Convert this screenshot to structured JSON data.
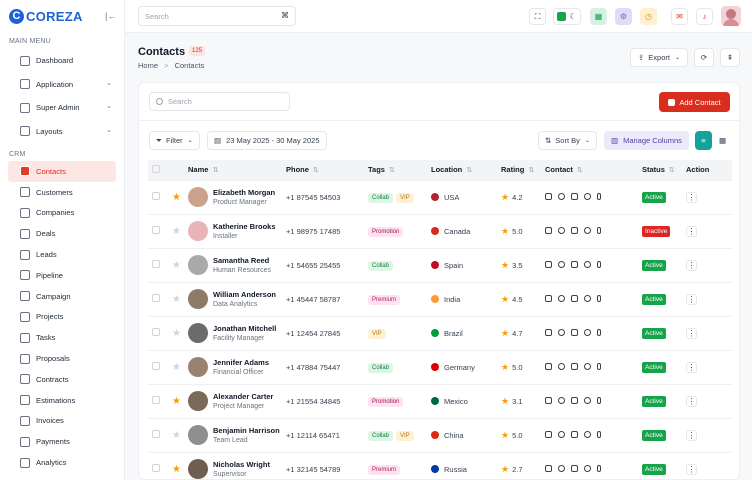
{
  "brand": {
    "name": "COREZA",
    "logo_letter": "C"
  },
  "sidebar": {
    "main_menu_label": "MAIN MENU",
    "main_items": [
      {
        "label": "Dashboard",
        "icon": "dashboard-icon",
        "chevron": false
      },
      {
        "label": "Application",
        "icon": "application-icon",
        "chevron": true
      },
      {
        "label": "Super Admin",
        "icon": "user-shield-icon",
        "chevron": true
      },
      {
        "label": "Layouts",
        "icon": "layout-icon",
        "chevron": true
      }
    ],
    "crm_label": "CRM",
    "crm_items": [
      {
        "label": "Contacts",
        "icon": "contacts-icon",
        "active": true
      },
      {
        "label": "Customers",
        "icon": "customers-icon"
      },
      {
        "label": "Companies",
        "icon": "companies-icon"
      },
      {
        "label": "Deals",
        "icon": "deals-icon"
      },
      {
        "label": "Leads",
        "icon": "leads-icon"
      },
      {
        "label": "Pipeline",
        "icon": "pipeline-icon"
      },
      {
        "label": "Campaign",
        "icon": "campaign-icon"
      },
      {
        "label": "Projects",
        "icon": "projects-icon"
      },
      {
        "label": "Tasks",
        "icon": "tasks-icon"
      },
      {
        "label": "Proposals",
        "icon": "proposals-icon"
      },
      {
        "label": "Contracts",
        "icon": "contracts-icon"
      },
      {
        "label": "Estimations",
        "icon": "estimations-icon"
      },
      {
        "label": "Invoices",
        "icon": "invoices-icon"
      },
      {
        "label": "Payments",
        "icon": "payments-icon"
      },
      {
        "label": "Analytics",
        "icon": "analytics-icon"
      }
    ]
  },
  "topbar": {
    "search_placeholder": "Search",
    "search_kbd": "⌘"
  },
  "page": {
    "title": "Contacts",
    "count": "125",
    "breadcrumb_home": "Home",
    "breadcrumb_sep": ">",
    "breadcrumb_current": "Contacts",
    "export_label": "Export"
  },
  "toolbar": {
    "search_placeholder": "Search",
    "add_label": "Add Contact",
    "filter_label": "Filter",
    "date_range": "23 May 2025 - 30 May 2025",
    "sort_label": "Sort By",
    "columns_label": "Manage Columns"
  },
  "table": {
    "headers": {
      "name": "Name",
      "phone": "Phone",
      "tags": "Tags",
      "location": "Location",
      "rating": "Rating",
      "contact": "Contact",
      "status": "Status",
      "action": "Action"
    },
    "rows": [
      {
        "name": "Elizabeth Morgan",
        "role": "Product Manager",
        "phone": "+1 87545 54503",
        "tags": [
          "Collab",
          "VIP"
        ],
        "location": "USA",
        "rating": "4.2",
        "starred": true,
        "status": "Active",
        "avatar_color": "#c9a38b",
        "flag_color": "#b22234"
      },
      {
        "name": "Katherine Brooks",
        "role": "Installer",
        "phone": "+1 98975 17485",
        "tags": [
          "Promotion"
        ],
        "location": "Canada",
        "rating": "5.0",
        "starred": false,
        "status": "Inactive",
        "avatar_color": "#e8b4b8",
        "flag_color": "#d52b1e"
      },
      {
        "name": "Samantha Reed",
        "role": "Human Resources",
        "phone": "+1 54655 25455",
        "tags": [
          "Collab"
        ],
        "location": "Spain",
        "rating": "3.5",
        "starred": false,
        "status": "Active",
        "avatar_color": "#a9a9a9",
        "flag_color": "#c60b1e"
      },
      {
        "name": "William Anderson",
        "role": "Data Analytics",
        "phone": "+1 45447 58787",
        "tags": [
          "Premium"
        ],
        "location": "India",
        "rating": "4.5",
        "starred": false,
        "status": "Active",
        "avatar_color": "#8d7b6a",
        "flag_color": "#ff9933"
      },
      {
        "name": "Jonathan Mitchell",
        "role": "Facility Manager",
        "phone": "+1 12454 27845",
        "tags": [
          "VIP"
        ],
        "location": "Brazil",
        "rating": "4.7",
        "starred": false,
        "status": "Active",
        "avatar_color": "#6b6b6b",
        "flag_color": "#009c3b"
      },
      {
        "name": "Jennifer Adams",
        "role": "Financial Officer",
        "phone": "+1 47884 75447",
        "tags": [
          "Collab"
        ],
        "location": "Germany",
        "rating": "5.0",
        "starred": false,
        "status": "Active",
        "avatar_color": "#9a8272",
        "flag_color": "#dd0000"
      },
      {
        "name": "Alexander Carter",
        "role": "Project Manager",
        "phone": "+1 21554 34845",
        "tags": [
          "Promotion"
        ],
        "location": "Mexico",
        "rating": "3.1",
        "starred": true,
        "status": "Active",
        "avatar_color": "#7a6858",
        "flag_color": "#006847"
      },
      {
        "name": "Benjamin Harrison",
        "role": "Team Lead",
        "phone": "+1 12114 65471",
        "tags": [
          "Collab",
          "VIP"
        ],
        "location": "China",
        "rating": "5.0",
        "starred": false,
        "status": "Active",
        "avatar_color": "#8f8f8f",
        "flag_color": "#de2910"
      },
      {
        "name": "Nicholas Wright",
        "role": "Supervisor",
        "phone": "+1 32145 54789",
        "tags": [
          "Premium"
        ],
        "location": "Russia",
        "rating": "2.7",
        "starred": true,
        "status": "Active",
        "avatar_color": "#6e5d50",
        "flag_color": "#0039a6"
      }
    ]
  },
  "colors": {
    "accent": "#d92d20",
    "brand": "#1e63d6",
    "active_status": "#16a34a",
    "inactive_status": "#dc2626",
    "star": "#f59e0b"
  }
}
